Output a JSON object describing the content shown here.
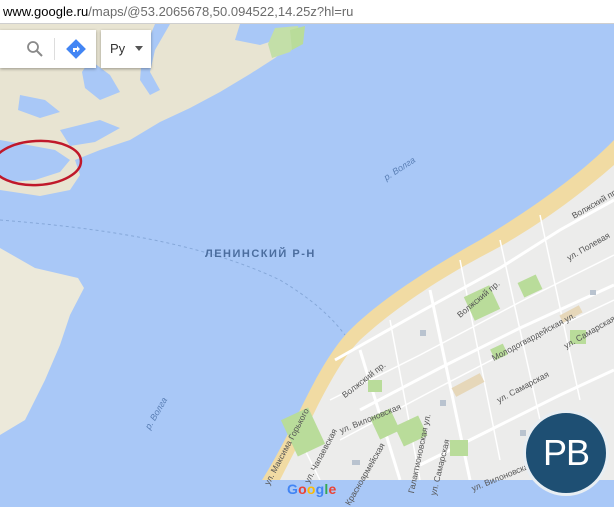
{
  "browser": {
    "url_host": "www.google.ru",
    "url_path": "/maps/@53.2065678,50.094522,14.25z?hl=ru"
  },
  "search_panel": {
    "search_icon": "search-icon",
    "directions_icon": "directions-icon",
    "language_value": "Ру"
  },
  "map_labels": {
    "district": "ЛЕНИНСКИЙ Р-Н",
    "river_upper": "р. Волга",
    "river_lower": "р. Волга"
  },
  "streets": {
    "volzhsky_pr_top": "Волжский пр",
    "volzhsky_pr_mid": "Волжский пр.",
    "volzhsky_pr_low": "Волжский пр.",
    "poleva": "ул. Полевая",
    "molodogvardeyskaya": "Молодогвардейская ул.",
    "samarskaya_right": "ул. Самарская",
    "samarskaya_mid": "ул. Самарская",
    "samarskaya_low": "ул. Самарская",
    "vilonovskaya_1": "ул. Вилоновская",
    "vilonovskaya_2": "ул. Вилоновская",
    "galaktionovskaya": "Галактионовская ул.",
    "chapaevskaya": "ул. Чапаевская",
    "maxim_gorky": "ул. Максима Горького",
    "krasnoarmeyskaya": "Красноармейская"
  },
  "branding": {
    "google_letters": [
      "G",
      "o",
      "o",
      "g",
      "l",
      "e"
    ],
    "google_colors": [
      "#4285F4",
      "#EA4335",
      "#FBBC05",
      "#4285F4",
      "#34A853",
      "#EA4335"
    ],
    "watermark": "PB",
    "watermark_color": "#1e4f73"
  },
  "colors": {
    "water": "#a9c8f7",
    "land": "#ededea",
    "sand": "#e8e3cf",
    "beach": "#f2dfaa",
    "park": "#b9dc9a",
    "marker": "#c0182a"
  }
}
